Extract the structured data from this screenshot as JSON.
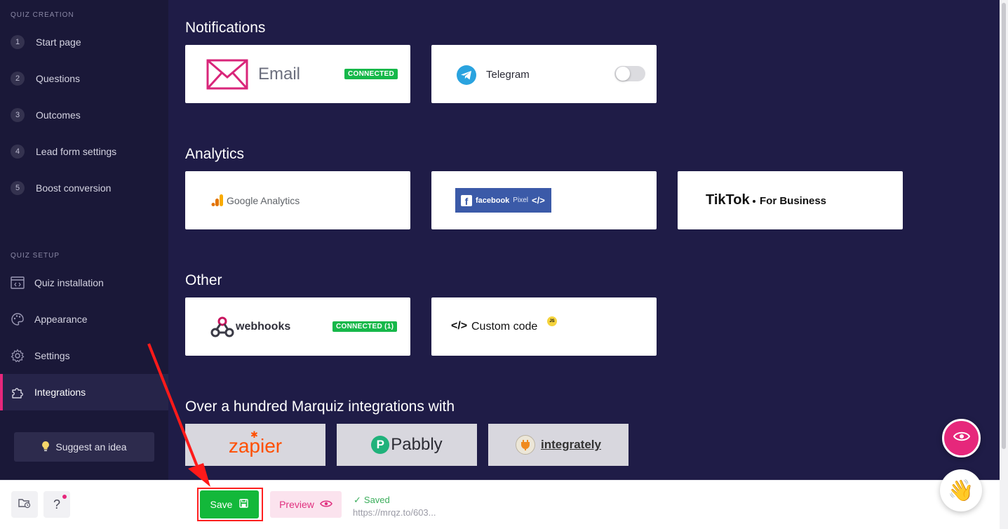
{
  "sidebar": {
    "quiz_creation_title": "QUIZ CREATION",
    "steps": [
      {
        "num": "1",
        "label": "Start page"
      },
      {
        "num": "2",
        "label": "Questions"
      },
      {
        "num": "3",
        "label": "Outcomes"
      },
      {
        "num": "4",
        "label": "Lead form settings"
      },
      {
        "num": "5",
        "label": "Boost conversion"
      }
    ],
    "quiz_setup_title": "QUIZ SETUP",
    "setup_items": [
      {
        "label": "Quiz installation",
        "icon": "code-window-icon"
      },
      {
        "label": "Appearance",
        "icon": "palette-icon"
      },
      {
        "label": "Settings",
        "icon": "gear-icon"
      },
      {
        "label": "Integrations",
        "icon": "puzzle-icon",
        "active": true
      }
    ],
    "suggest_label": "Suggest an idea"
  },
  "sections": {
    "notifications": "Notifications",
    "analytics": "Analytics",
    "other": "Other",
    "more": "Over a hundred Marquiz integrations with"
  },
  "cards": {
    "email": {
      "label": "Email",
      "badge": "CONNECTED"
    },
    "telegram": {
      "label": "Telegram",
      "enabled": false
    },
    "google_analytics": {
      "label": "Google Analytics"
    },
    "facebook": {
      "label": "facebook",
      "sub": "Pixel",
      "code": "</>"
    },
    "tiktok": {
      "label": "TikTok",
      "sub": "For Business"
    },
    "webhooks": {
      "label": "webhooks",
      "badge": "CONNECTED (1)"
    },
    "custom_code": {
      "label": "Custom code",
      "badge": "JS",
      "code": "</>"
    }
  },
  "partners": {
    "zapier": "zapier",
    "pabbly": "Pabbly",
    "integrately": "integrately"
  },
  "bottom": {
    "help": "?",
    "save": "Save",
    "preview": "Preview",
    "saved": "Saved",
    "link": "https://mrqz.to/603..."
  },
  "colors": {
    "accent": "#e6277b",
    "green": "#13b83a",
    "sidebar_bg": "#1a1838",
    "main_bg": "#1f1c47"
  }
}
